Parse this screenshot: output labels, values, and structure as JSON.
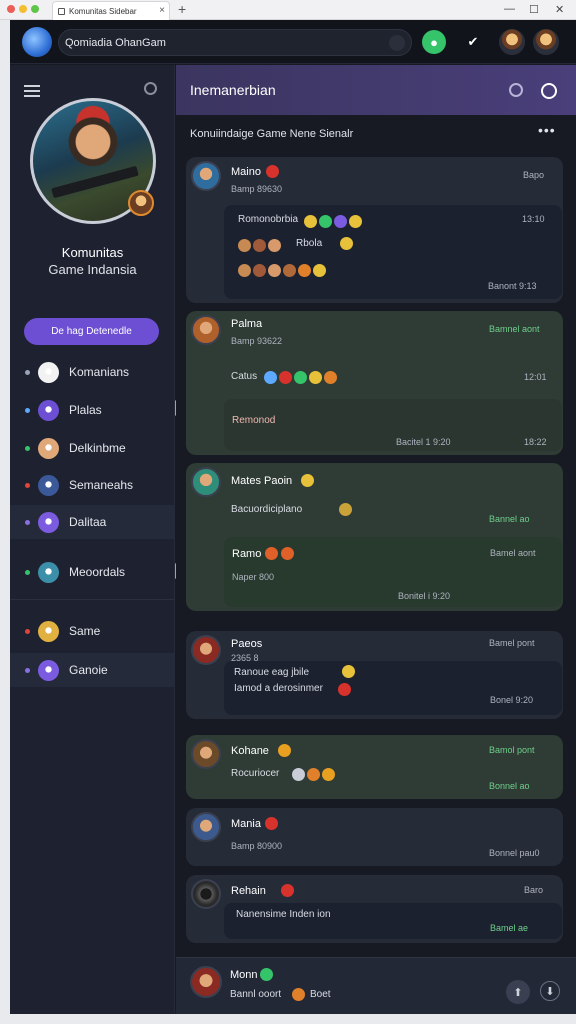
{
  "browser": {
    "tab_title": "Komunitas Sidebar"
  },
  "search": {
    "value": "Qomiadia OhanGam"
  },
  "sidebar": {
    "profile_name": "Komunitas",
    "profile_subtitle": "Game Indansia",
    "primary_button": "De hag Detenedle",
    "items": [
      {
        "label": "Komanians",
        "bullet": "#9aa3b8",
        "icon": "#f2f2f2"
      },
      {
        "label": "Plalas",
        "bullet": "#5da9ff",
        "icon": "#6c4fd3"
      },
      {
        "label": "Delkinbme",
        "bullet": "#35c46a",
        "icon": "#e0a878"
      },
      {
        "label": "Semaneahs",
        "bullet": "#e0443a",
        "icon": "#3b5998"
      },
      {
        "label": "Dalitaa",
        "bullet": "#8a6fe0",
        "icon": "#7b5ce0"
      },
      {
        "label": "Meoordals",
        "bullet": "#35c46a",
        "icon": "#3c8fa8"
      },
      {
        "label": "Same",
        "bullet": "#e0443a",
        "icon": "#e0b040"
      },
      {
        "label": "Ganoie",
        "bullet": "#8a6fe0",
        "icon": "#7b5ce0"
      }
    ]
  },
  "main": {
    "title": "Inemanerbian",
    "subtitle": "Konuiindaige Game Nene Sienalr",
    "more": "•••"
  },
  "posts": [
    {
      "name": "Maino",
      "meta": "Bamp 89630",
      "time": "Bapo",
      "inner_title": "Romonobrbia",
      "inner_time": "13:10",
      "inner_mid": "Rbola",
      "inner_footer": "Banont 9:13"
    },
    {
      "name": "Palma",
      "meta": "Bamp 93622",
      "time": "Bamnel aont",
      "line": "Catus",
      "line_time": "12:01",
      "reply": "Remonod",
      "footer_a": "Bacitel 1 9:20",
      "footer_b": "18:22"
    },
    {
      "name": "Mates Paoin",
      "line": "Bacuordiciplano",
      "time": "Bannel ao",
      "inner_name": "Ramo",
      "inner_meta": "Naper 800",
      "inner_time": "Bamel aont",
      "inner_footer": "Bonitel i 9:20"
    },
    {
      "name": "Paeos",
      "meta": "2365 8",
      "time": "Bamel pont",
      "line_a": "Ranoue eag jbile",
      "line_b": "Iamod a derosinmer",
      "footer": "Bonel 9:20"
    },
    {
      "name": "Kohane",
      "time": "Bamol pont",
      "line": "Rocuriocer",
      "footer": "Bonnel ao"
    },
    {
      "name": "Mania",
      "meta": "Bamp 80900",
      "footer": "Bonnel pau0"
    },
    {
      "name": "Rehain",
      "time": "Baro",
      "line": "Nanensime Inden ion",
      "footer": "Bamel ae"
    }
  ],
  "composer": {
    "name": "Monn",
    "text": "Bannl ooort",
    "extra": "Boet"
  },
  "colors": {
    "accent": "#6c4fd3",
    "header": "#4a3f7a",
    "online": "#35c46a"
  }
}
